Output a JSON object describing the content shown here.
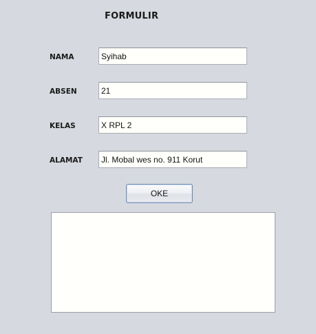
{
  "form": {
    "title": "FORMULIR",
    "fields": [
      {
        "label": "NAMA",
        "value": "Syihab"
      },
      {
        "label": "ABSEN",
        "value": "21"
      },
      {
        "label": "KELAS",
        "value": "X RPL 2"
      },
      {
        "label": "ALAMAT",
        "value": "Jl. Mobal wes no. 911 Korut"
      }
    ],
    "submit_label": "OKE",
    "output_text": ""
  }
}
